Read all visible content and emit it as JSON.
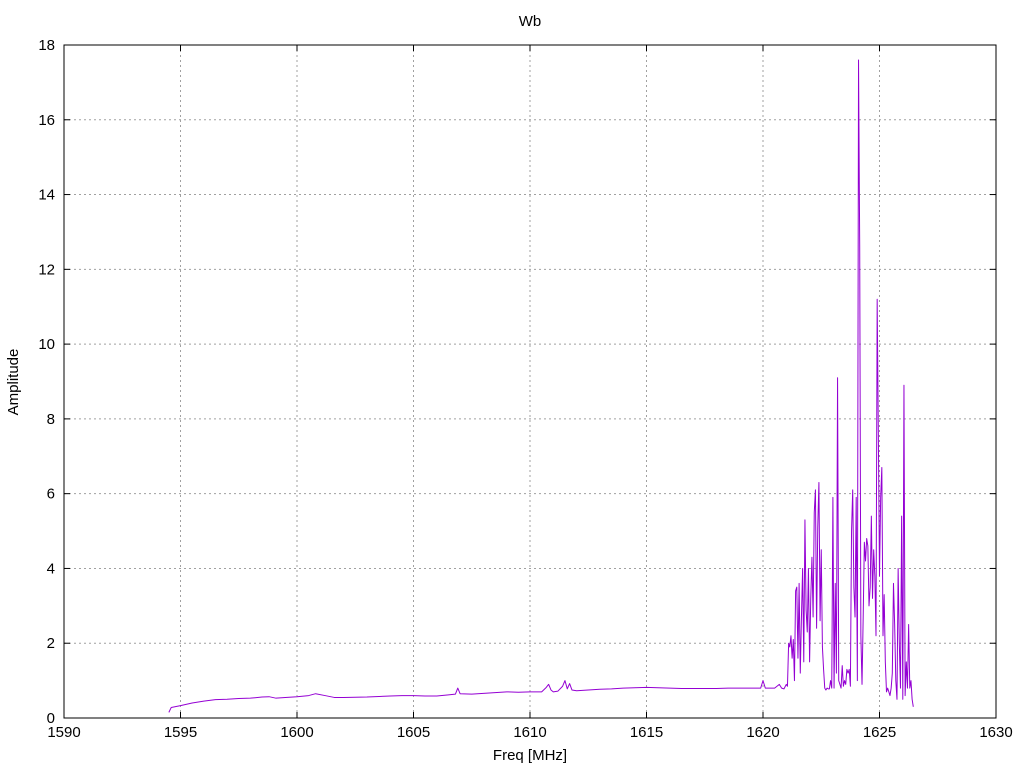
{
  "chart_data": {
    "type": "line",
    "title": "Wb",
    "xlabel": "Freq [MHz]",
    "ylabel": "Amplitude",
    "xlim": [
      1590,
      1630
    ],
    "ylim": [
      0,
      18
    ],
    "xticks": [
      1590,
      1595,
      1600,
      1605,
      1610,
      1615,
      1620,
      1625,
      1630
    ],
    "yticks": [
      0,
      2,
      4,
      6,
      8,
      10,
      12,
      14,
      16,
      18
    ],
    "grid": true,
    "legend": "none",
    "series": [
      {
        "color": "#9400d3",
        "x": [
          1594.5,
          1594.6,
          1595.0,
          1595.5,
          1596.0,
          1596.5,
          1597.0,
          1597.5,
          1598.0,
          1598.5,
          1598.8,
          1599.1,
          1599.5,
          1600.0,
          1600.5,
          1600.8,
          1601.2,
          1601.6,
          1602.0,
          1603.0,
          1604.0,
          1604.5,
          1605.0,
          1605.5,
          1606.0,
          1606.5,
          1606.8,
          1606.9,
          1607.0,
          1607.5,
          1608.0,
          1608.5,
          1609.0,
          1609.5,
          1610.0,
          1610.5,
          1610.7,
          1610.8,
          1610.9,
          1611.0,
          1611.2,
          1611.4,
          1611.5,
          1611.6,
          1611.7,
          1611.8,
          1612.0,
          1612.5,
          1613.0,
          1613.5,
          1614.0,
          1614.5,
          1615.0,
          1615.5,
          1616.0,
          1616.5,
          1617.0,
          1617.5,
          1618.0,
          1618.5,
          1619.0,
          1619.5,
          1619.9,
          1620.0,
          1620.1,
          1620.3,
          1620.5,
          1620.7,
          1620.8,
          1620.9,
          1621.0,
          1621.05,
          1621.1,
          1621.15,
          1621.2,
          1621.25,
          1621.3,
          1621.35,
          1621.4,
          1621.45,
          1621.5,
          1621.55,
          1621.6,
          1621.65,
          1621.7,
          1621.75,
          1621.8,
          1621.85,
          1621.9,
          1621.95,
          1622.0,
          1622.05,
          1622.1,
          1622.15,
          1622.2,
          1622.25,
          1622.3,
          1622.35,
          1622.4,
          1622.45,
          1622.5,
          1622.55,
          1622.6,
          1622.65,
          1622.7,
          1622.75,
          1622.8,
          1622.85,
          1622.9,
          1622.95,
          1623.0,
          1623.05,
          1623.1,
          1623.15,
          1623.2,
          1623.25,
          1623.3,
          1623.35,
          1623.4,
          1623.45,
          1623.5,
          1623.55,
          1623.6,
          1623.65,
          1623.7,
          1623.75,
          1623.8,
          1623.85,
          1623.9,
          1623.95,
          1624.0,
          1624.05,
          1624.1,
          1624.15,
          1624.2,
          1624.25,
          1624.3,
          1624.35,
          1624.4,
          1624.45,
          1624.5,
          1624.55,
          1624.6,
          1624.65,
          1624.7,
          1624.75,
          1624.8,
          1624.85,
          1624.9,
          1624.95,
          1625.0,
          1625.05,
          1625.1,
          1625.15,
          1625.2,
          1625.25,
          1625.3,
          1625.35,
          1625.4,
          1625.45,
          1625.5,
          1625.55,
          1625.6,
          1625.65,
          1625.7,
          1625.75,
          1625.8,
          1625.85,
          1625.9,
          1625.95,
          1626.0,
          1626.05,
          1626.1,
          1626.15,
          1626.2,
          1626.25,
          1626.3,
          1626.35,
          1626.4,
          1626.45
        ],
        "y": [
          0.15,
          0.28,
          0.33,
          0.4,
          0.45,
          0.49,
          0.5,
          0.52,
          0.53,
          0.56,
          0.57,
          0.53,
          0.55,
          0.57,
          0.6,
          0.65,
          0.6,
          0.55,
          0.55,
          0.56,
          0.59,
          0.6,
          0.6,
          0.59,
          0.59,
          0.62,
          0.64,
          0.8,
          0.65,
          0.64,
          0.66,
          0.68,
          0.7,
          0.69,
          0.7,
          0.7,
          0.82,
          0.9,
          0.75,
          0.7,
          0.72,
          0.85,
          1.0,
          0.78,
          0.92,
          0.75,
          0.73,
          0.75,
          0.77,
          0.78,
          0.8,
          0.81,
          0.82,
          0.81,
          0.8,
          0.79,
          0.79,
          0.79,
          0.79,
          0.8,
          0.8,
          0.8,
          0.8,
          1.0,
          0.8,
          0.8,
          0.8,
          0.9,
          0.8,
          0.78,
          0.9,
          0.85,
          2.0,
          1.9,
          2.2,
          1.6,
          2.1,
          1.0,
          3.4,
          3.5,
          1.6,
          3.6,
          1.2,
          2.7,
          4.0,
          1.5,
          5.3,
          2.9,
          2.3,
          4.0,
          1.5,
          3.2,
          4.3,
          2.7,
          5.5,
          6.1,
          2.4,
          5.1,
          6.3,
          2.6,
          4.5,
          1.9,
          1.3,
          0.8,
          0.75,
          0.8,
          0.78,
          0.78,
          1.0,
          0.8,
          5.9,
          0.8,
          3.6,
          1.2,
          9.1,
          1.0,
          0.9,
          0.8,
          1.4,
          0.85,
          1.0,
          0.9,
          1.3,
          1.2,
          1.3,
          0.85,
          5.0,
          6.1,
          3.5,
          2.7,
          5.9,
          1.0,
          17.6,
          12.6,
          2.2,
          0.9,
          2.7,
          4.7,
          4.2,
          4.8,
          4.6,
          3.0,
          3.5,
          5.4,
          3.2,
          4.5,
          3.8,
          2.2,
          11.2,
          7.6,
          3.8,
          5.9,
          6.7,
          2.2,
          3.3,
          1.5,
          0.7,
          0.8,
          0.7,
          0.6,
          0.8,
          1.2,
          3.6,
          2.5,
          1.0,
          0.5,
          4.0,
          2.0,
          0.8,
          5.4,
          0.5,
          8.9,
          0.6,
          1.5,
          0.8,
          2.5,
          0.8,
          1.0,
          0.5,
          0.3
        ]
      }
    ]
  }
}
